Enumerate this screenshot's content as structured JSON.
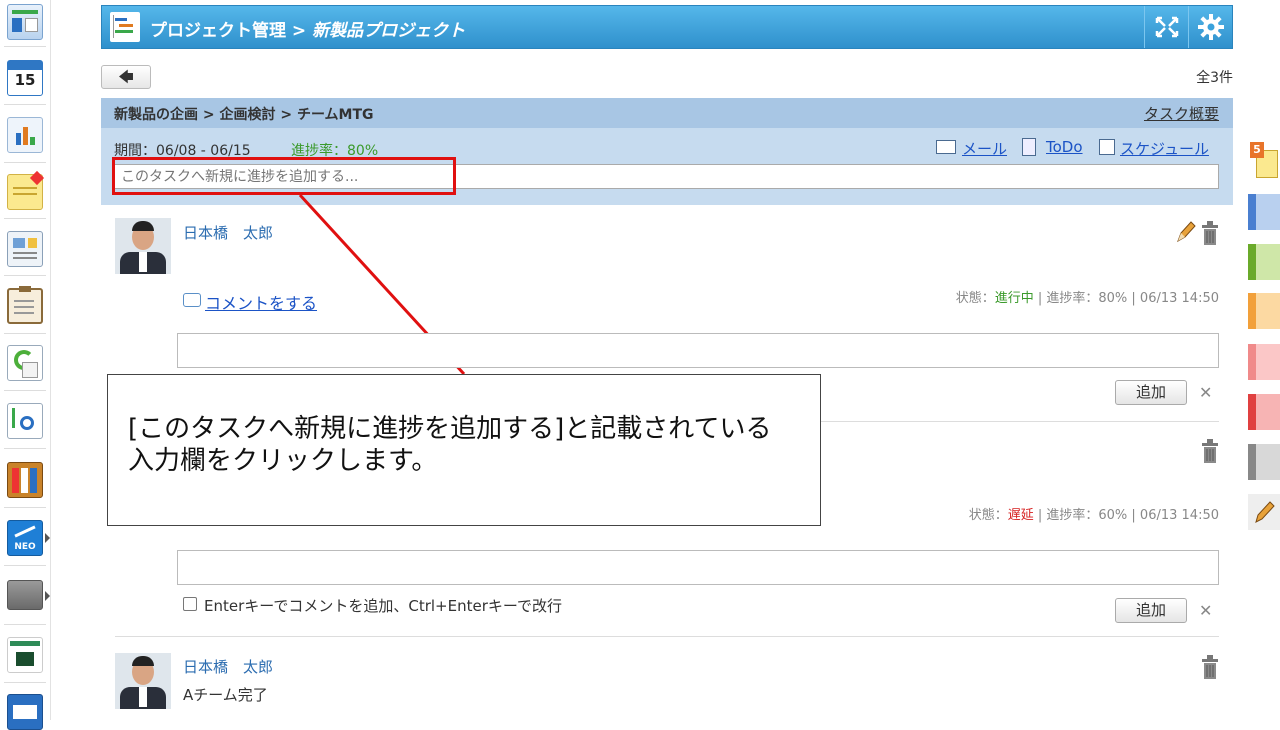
{
  "header": {
    "title_prefix": "プロジェクト管理 > ",
    "project_name": "新製品プロジェクト"
  },
  "toolbar": {
    "back_label": "🡄",
    "total_count": "全3件"
  },
  "task": {
    "breadcrumb": "新製品の企画 > 企画検討 > チームMTG",
    "summary_link": "タスク概要",
    "period": "期間：06/08 - 06/15",
    "progress": "進捗率：80%",
    "links": {
      "mail": "メール",
      "todo": "ToDo",
      "schedule": "スケジュール"
    },
    "progress_placeholder": "このタスクへ新規に進捗を追加する..."
  },
  "entries": [
    {
      "author": "日本橋　太郎",
      "comment_link": "コメントをする",
      "status_label": "状態：",
      "status_value": "進行中",
      "status_color": "#3b9a2b",
      "meta": " | 進捗率：80% | 06/13 14:50",
      "add_label": "追加"
    },
    {
      "status_label": "状態：",
      "status_value": "遅延",
      "status_color": "#d62020",
      "meta": " | 進捗率：60% | 06/13 14:50",
      "enter_hint": "Enterキーでコメントを追加、Ctrl+Enterキーで改行",
      "add_label": "追加"
    },
    {
      "author": "日本橋　太郎",
      "text": "Aチーム完了"
    }
  ],
  "callout": {
    "line1": "[このタスクへ新規に進捗を追加する]と記載されている",
    "line2": "入力欄をクリックします。"
  },
  "colors": {
    "header": "#3aa2dc",
    "panel": "#c6dbef",
    "highlight": "#e01010",
    "link": "#1b53c6"
  },
  "rail_icons": [
    "dashboard-icon",
    "calendar-icon",
    "chart-icon",
    "memo-icon",
    "report-icon",
    "clipboard-icon",
    "refresh-doc-icon",
    "search-doc-icon",
    "binder-icon",
    "neo-icon",
    "folder-icon",
    "logo-icon",
    "mail-icon"
  ],
  "rail_calendar_day": "15"
}
